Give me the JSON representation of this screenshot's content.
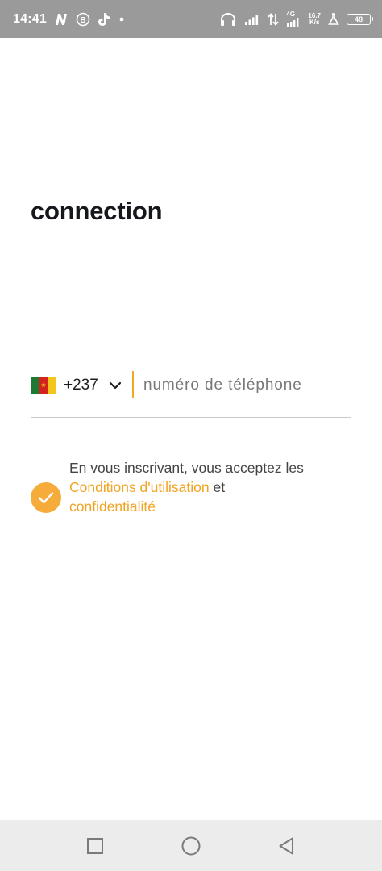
{
  "status_bar": {
    "time": "14:41",
    "network_speed_value": "16.7",
    "network_speed_unit": "K/s",
    "network_type": "4G",
    "battery_level": "48",
    "icons": [
      "n-app-icon",
      "b-circle-icon",
      "tiktok-icon",
      "dot-icon",
      "headphones-icon",
      "signal-icon",
      "data-arrows-icon",
      "signal-4g-icon",
      "flask-icon",
      "battery-icon"
    ]
  },
  "page": {
    "title": "connection"
  },
  "phone": {
    "country_flag": "cameroon-flag-icon",
    "country_code": "+237",
    "placeholder": "numéro de téléphone",
    "value": ""
  },
  "terms": {
    "checked": true,
    "text_intro": "En vous inscrivant, vous acceptez les",
    "link_terms": "Conditions d'utilisation",
    "conjunction": "et",
    "link_privacy": "confidentialité"
  },
  "colors": {
    "accent": "#f5a623",
    "check_bg": "#f5ac3b",
    "status_bar_bg": "#9a9a9a",
    "nav_bar_bg": "#ececec",
    "title": "#16171c"
  },
  "nav_bar": {
    "buttons": [
      "square-recents-icon",
      "circle-home-icon",
      "triangle-back-icon"
    ]
  }
}
